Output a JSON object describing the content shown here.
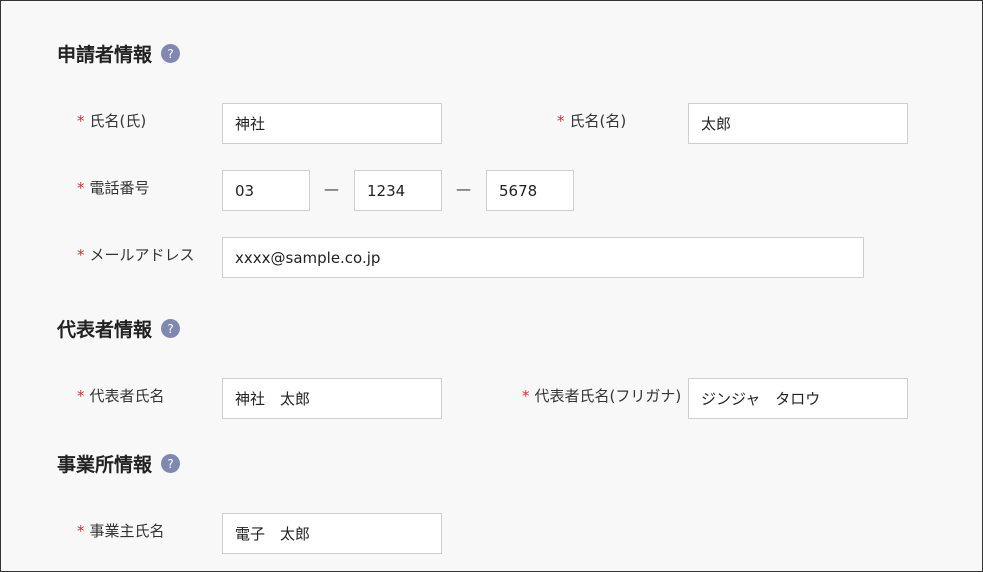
{
  "sections": {
    "applicant": {
      "title": "申請者情報",
      "help": "?"
    },
    "representative": {
      "title": "代表者情報",
      "help": "?"
    },
    "office": {
      "title": "事業所情報",
      "help": "?"
    }
  },
  "fields": {
    "required_mark": "*",
    "last_name": {
      "label": "氏名(氏)",
      "value": "神社"
    },
    "first_name": {
      "label": "氏名(名)",
      "value": "太郎"
    },
    "phone": {
      "label": "電話番号",
      "part1": "03",
      "part2": "1234",
      "part3": "5678",
      "separator": "—"
    },
    "email": {
      "label": "メールアドレス",
      "value": "xxxx@sample.co.jp"
    },
    "rep_name": {
      "label": "代表者氏名",
      "value": "神社　太郎"
    },
    "rep_name_kana": {
      "label": "代表者氏名(フリガナ)",
      "value": "ジンジャ　タロウ"
    },
    "owner_name": {
      "label": "事業主氏名",
      "value": "電子　太郎"
    }
  }
}
